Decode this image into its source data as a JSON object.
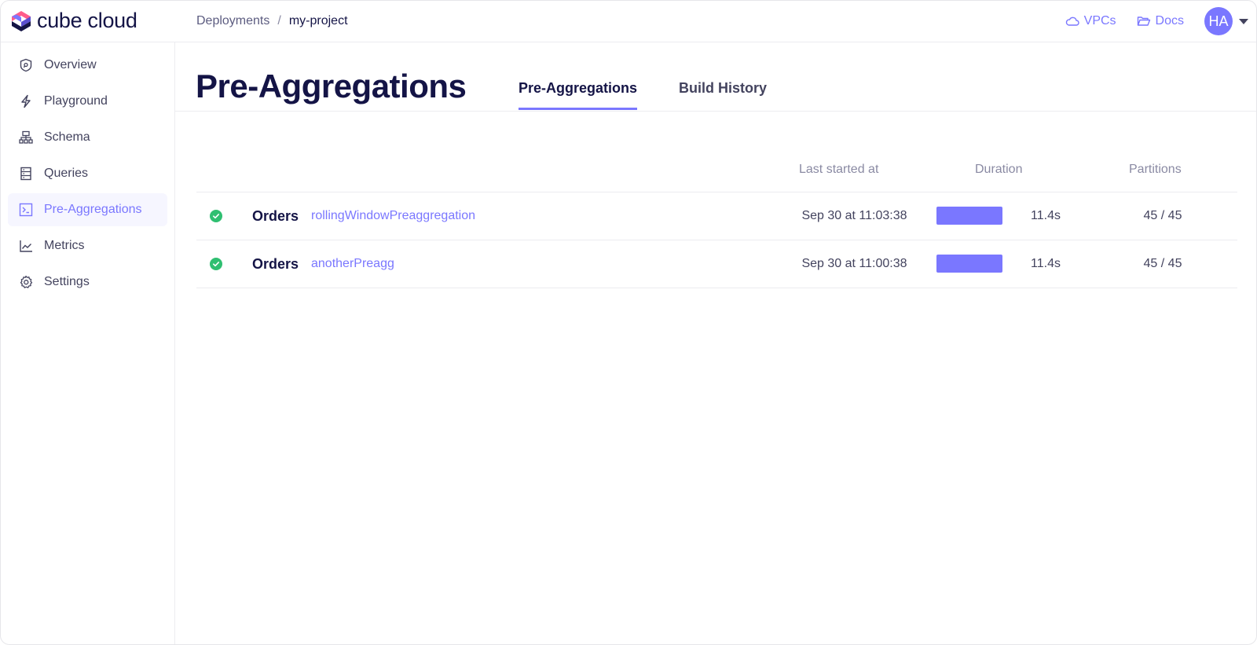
{
  "app": {
    "name": "cube cloud"
  },
  "breadcrumb": {
    "parent": "Deployments",
    "separator": "/",
    "current": "my-project"
  },
  "header_links": {
    "vpcs": "VPCs",
    "docs": "Docs"
  },
  "user": {
    "initials": "HA"
  },
  "sidebar": {
    "items": [
      {
        "label": "Overview",
        "icon": "shield-icon",
        "active": false
      },
      {
        "label": "Playground",
        "icon": "lightning-icon",
        "active": false
      },
      {
        "label": "Schema",
        "icon": "sitemap-icon",
        "active": false
      },
      {
        "label": "Queries",
        "icon": "database-icon",
        "active": false
      },
      {
        "label": "Pre-Aggregations",
        "icon": "terminal-icon",
        "active": true
      },
      {
        "label": "Metrics",
        "icon": "chart-line-icon",
        "active": false
      },
      {
        "label": "Settings",
        "icon": "gear-icon",
        "active": false
      }
    ]
  },
  "page": {
    "title": "Pre-Aggregations",
    "tabs": [
      {
        "label": "Pre-Aggregations",
        "active": true
      },
      {
        "label": "Build History",
        "active": false
      }
    ]
  },
  "table": {
    "columns": {
      "last_started": "Last started at",
      "duration": "Duration",
      "partitions": "Partitions"
    },
    "rows": [
      {
        "status": "success",
        "cube": "Orders",
        "preaggregation": "rollingWindowPreaggregation",
        "last_started": "Sep 30 at 11:03:38",
        "duration_fraction": 1.0,
        "duration": "11.4s",
        "partitions": "45 / 45"
      },
      {
        "status": "success",
        "cube": "Orders",
        "preaggregation": "anotherPreagg",
        "last_started": "Sep 30 at 11:00:38",
        "duration_fraction": 1.0,
        "duration": "11.4s",
        "partitions": "45 / 45"
      }
    ]
  },
  "colors": {
    "accent": "#7a77ff",
    "text": "#141446",
    "success": "#2fbf71",
    "active_bg": "#f6f6ff"
  }
}
